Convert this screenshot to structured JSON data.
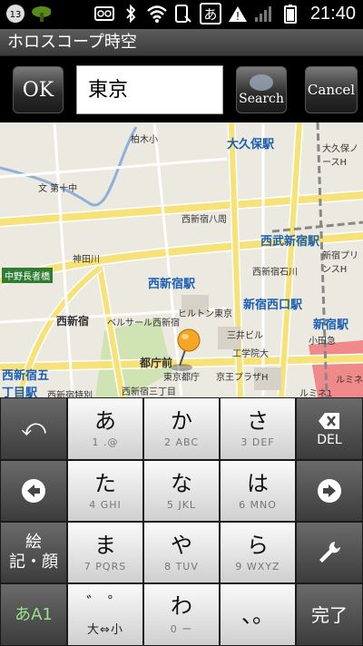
{
  "status_bar": {
    "notification_badge": "13",
    "time": "21:40",
    "ime_indicator": "あ",
    "icons": [
      "notification-count-icon",
      "leaf-icon",
      "voicemail-icon",
      "bluetooth-icon",
      "wifi-icon",
      "phone-icon",
      "ime-icon",
      "warning-icon",
      "signal-icon",
      "battery-icon"
    ]
  },
  "app": {
    "title": "ホロスコープ時空"
  },
  "toolbar": {
    "ok_label": "OK",
    "search_value": "東京",
    "search_label": "Search",
    "cancel_label": "Cancel"
  },
  "map": {
    "labels": [
      {
        "text": "大久保駅",
        "cls": "big"
      },
      {
        "text": "西武新宿駅",
        "cls": "big"
      },
      {
        "text": "西新宿駅",
        "cls": "big"
      },
      {
        "text": "新宿西口駅",
        "cls": "big"
      },
      {
        "text": "新宿駅",
        "cls": "big"
      },
      {
        "text": "都庁前",
        "cls": "bigdark"
      },
      {
        "text": "西新宿",
        "cls": "bigdark"
      },
      {
        "text": "西新宿五丁目駅",
        "cls": "big"
      },
      {
        "text": "中野長者橋",
        "cls": ""
      },
      {
        "text": "柏木小",
        "cls": ""
      },
      {
        "text": "文 第十中",
        "cls": ""
      },
      {
        "text": "神田川",
        "cls": ""
      },
      {
        "text": "西新宿八周",
        "cls": ""
      },
      {
        "text": "ヒルトン東京",
        "cls": ""
      },
      {
        "text": "ベルサール西新宿",
        "cls": ""
      },
      {
        "text": "三井ビル",
        "cls": ""
      },
      {
        "text": "工学院大",
        "cls": ""
      },
      {
        "text": "京王プラザH",
        "cls": ""
      },
      {
        "text": "東京都庁",
        "cls": ""
      },
      {
        "text": "西新宿三丁目",
        "cls": ""
      },
      {
        "text": "西新宿特別",
        "cls": ""
      },
      {
        "text": "ルミネ1",
        "cls": ""
      },
      {
        "text": "ルミネ",
        "cls": ""
      },
      {
        "text": "小田急",
        "cls": ""
      },
      {
        "text": "新宿プリンスH",
        "cls": ""
      },
      {
        "text": "西新宿石川",
        "cls": ""
      },
      {
        "text": "大久保ノースH",
        "cls": ""
      }
    ]
  },
  "keyboard": {
    "left_keys": [
      {
        "name": "undo-key",
        "label": "⤺"
      },
      {
        "name": "cursor-left-key",
        "label": "◀"
      },
      {
        "name": "emoji-symbol-key",
        "label": "絵\n記・顔"
      },
      {
        "name": "input-mode-key",
        "label": "あA1"
      }
    ],
    "center_keys": [
      {
        "main": "あ",
        "sub": "1 .@"
      },
      {
        "main": "か",
        "sub": "2 ABC"
      },
      {
        "main": "さ",
        "sub": "3 DEF"
      },
      {
        "main": "た",
        "sub": "4 GHI"
      },
      {
        "main": "な",
        "sub": "5 JKL"
      },
      {
        "main": "は",
        "sub": "6 MNO"
      },
      {
        "main": "ま",
        "sub": "7 PQRS"
      },
      {
        "main": "や",
        "sub": "8 TUV"
      },
      {
        "main": "ら",
        "sub": "9 WXYZ"
      },
      {
        "main": "゛ ゜",
        "sub": "大⇔小"
      },
      {
        "main": "わ",
        "sub": "0 ー"
      },
      {
        "main": "、。",
        "sub": ""
      }
    ],
    "right_keys": [
      {
        "name": "delete-key",
        "label": "DEL"
      },
      {
        "name": "cursor-right-key",
        "label": "▶"
      },
      {
        "name": "settings-key",
        "label": "🔧"
      },
      {
        "name": "enter-key",
        "label": "完了"
      }
    ]
  }
}
